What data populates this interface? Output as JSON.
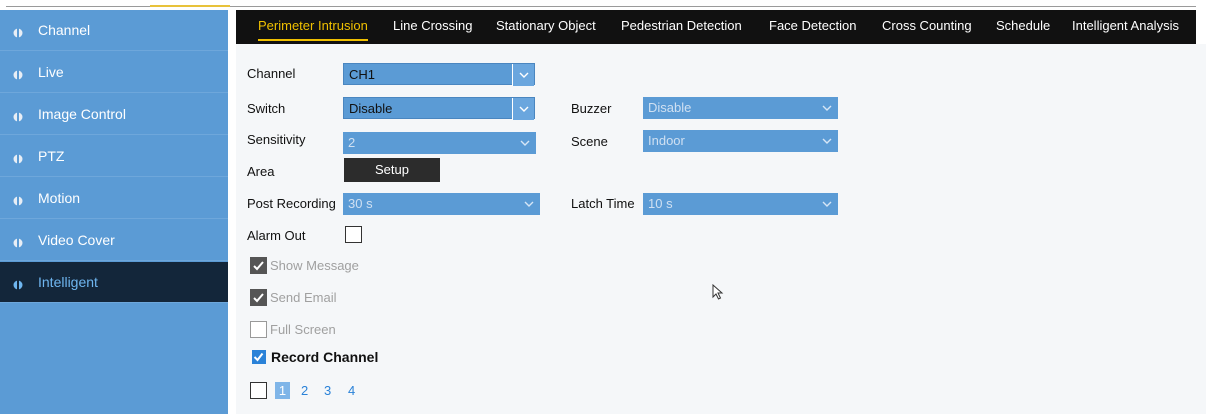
{
  "sidebar": {
    "items": [
      {
        "label": "Channel",
        "icon": "pin-icon"
      },
      {
        "label": "Live",
        "icon": "pin-icon"
      },
      {
        "label": "Image Control",
        "icon": "pin-icon"
      },
      {
        "label": "PTZ",
        "icon": "pin-icon"
      },
      {
        "label": "Motion",
        "icon": "pin-icon"
      },
      {
        "label": "Video Cover",
        "icon": "pin-icon"
      },
      {
        "label": "Intelligent",
        "icon": "pin-icon",
        "active": true
      }
    ]
  },
  "tabs": [
    {
      "label": "Perimeter Intrusion",
      "active": true
    },
    {
      "label": "Line Crossing"
    },
    {
      "label": "Stationary Object"
    },
    {
      "label": "Pedestrian Detection"
    },
    {
      "label": "Face Detection"
    },
    {
      "label": "Cross Counting"
    },
    {
      "label": "Schedule"
    },
    {
      "label": "Intelligent Analysis"
    }
  ],
  "form": {
    "channel": {
      "label": "Channel",
      "value": "CH1"
    },
    "switch": {
      "label": "Switch",
      "value": "Disable"
    },
    "buzzer": {
      "label": "Buzzer",
      "value": "Disable"
    },
    "sensitivity": {
      "label": "Sensitivity",
      "value": "2"
    },
    "scene": {
      "label": "Scene",
      "value": "Indoor"
    },
    "area": {
      "label": "Area",
      "button": "Setup"
    },
    "post_recording": {
      "label": "Post Recording",
      "value": "30 s"
    },
    "latch_time": {
      "label": "Latch Time",
      "value": "10 s"
    },
    "alarm_out": {
      "label": "Alarm Out",
      "checked": false
    },
    "show_message": {
      "label": "Show Message",
      "checked": true,
      "disabled": true
    },
    "send_email": {
      "label": "Send Email",
      "checked": true,
      "disabled": true
    },
    "full_screen": {
      "label": "Full Screen",
      "checked": false,
      "disabled": true
    },
    "record_channel": {
      "label": "Record Channel",
      "checked": true
    },
    "channels": [
      "1",
      "2",
      "3",
      "4"
    ]
  },
  "colors": {
    "sidebar": "#5b9bd5",
    "sidebar_active": "#13263a",
    "tab_active": "#f0c000",
    "select": "#5b9bd5"
  }
}
